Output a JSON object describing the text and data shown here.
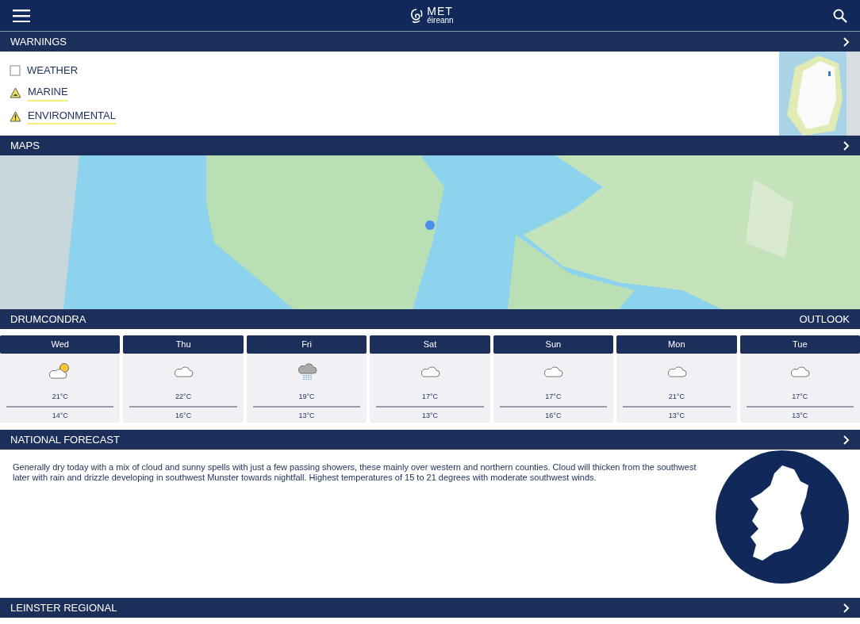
{
  "header": {
    "logo_top": "MET",
    "logo_bottom": "éireann"
  },
  "warnings": {
    "title": "WARNINGS",
    "items": [
      {
        "label": "WEATHER",
        "kind": "none"
      },
      {
        "label": "MARINE",
        "kind": "marine"
      },
      {
        "label": "ENVIRONMENTAL",
        "kind": "alert"
      }
    ]
  },
  "maps": {
    "title": "MAPS"
  },
  "forecast": {
    "title": "DRUMCONDRA",
    "link": "OUTLOOK",
    "days": [
      {
        "day": "Wed",
        "kind": "suncloud",
        "high": "21°C",
        "low": "14°C"
      },
      {
        "day": "Thu",
        "kind": "cloud",
        "high": "22°C",
        "low": "16°C"
      },
      {
        "day": "Fri",
        "kind": "rain",
        "high": "19°C",
        "low": "13°C"
      },
      {
        "day": "Sat",
        "kind": "cloud",
        "high": "17°C",
        "low": "13°C"
      },
      {
        "day": "Sun",
        "kind": "cloud",
        "high": "17°C",
        "low": "16°C"
      },
      {
        "day": "Mon",
        "kind": "cloud",
        "high": "21°C",
        "low": "13°C"
      },
      {
        "day": "Tue",
        "kind": "cloud",
        "high": "17°C",
        "low": "13°C"
      }
    ]
  },
  "national": {
    "title": "NATIONAL FORECAST",
    "text": "Generally dry today with a mix of cloud and sunny spells with just a few passing showers, these mainly over western and northern counties. Cloud will thicken from the southwest later with rain and drizzle developing in southwest Munster towards nightfall. Highest temperatures of 15 to 21 degrees with moderate southwest winds."
  },
  "regional": {
    "title": "LEINSTER REGIONAL"
  }
}
